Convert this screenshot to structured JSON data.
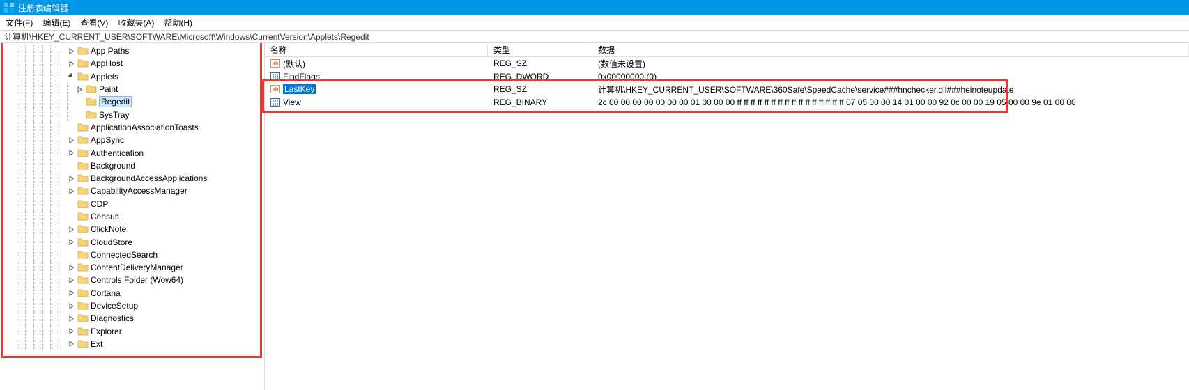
{
  "titlebar": {
    "title": "注册表编辑器"
  },
  "menubar": {
    "items": [
      "文件(F)",
      "编辑(E)",
      "查看(V)",
      "收藏夹(A)",
      "帮助(H)"
    ]
  },
  "addressbar": {
    "path": "计算机\\HKEY_CURRENT_USER\\SOFTWARE\\Microsoft\\Windows\\CurrentVersion\\Applets\\Regedit"
  },
  "tree": {
    "items": [
      {
        "label": "App Paths",
        "depth": 8,
        "exp": "closed"
      },
      {
        "label": "AppHost",
        "depth": 8,
        "exp": "closed"
      },
      {
        "label": "Applets",
        "depth": 8,
        "exp": "open"
      },
      {
        "label": "Paint",
        "depth": 9,
        "exp": "closed"
      },
      {
        "label": "Regedit",
        "depth": 9,
        "exp": "none",
        "selected": true
      },
      {
        "label": "SysTray",
        "depth": 9,
        "exp": "none"
      },
      {
        "label": "ApplicationAssociationToasts",
        "depth": 8,
        "exp": "none"
      },
      {
        "label": "AppSync",
        "depth": 8,
        "exp": "closed"
      },
      {
        "label": "Authentication",
        "depth": 8,
        "exp": "closed"
      },
      {
        "label": "Background",
        "depth": 8,
        "exp": "none"
      },
      {
        "label": "BackgroundAccessApplications",
        "depth": 8,
        "exp": "closed"
      },
      {
        "label": "CapabilityAccessManager",
        "depth": 8,
        "exp": "closed"
      },
      {
        "label": "CDP",
        "depth": 8,
        "exp": "none"
      },
      {
        "label": "Census",
        "depth": 8,
        "exp": "none"
      },
      {
        "label": "ClickNote",
        "depth": 8,
        "exp": "closed"
      },
      {
        "label": "CloudStore",
        "depth": 8,
        "exp": "closed"
      },
      {
        "label": "ConnectedSearch",
        "depth": 8,
        "exp": "none"
      },
      {
        "label": "ContentDeliveryManager",
        "depth": 8,
        "exp": "closed"
      },
      {
        "label": "Controls Folder (Wow64)",
        "depth": 8,
        "exp": "closed"
      },
      {
        "label": "Cortana",
        "depth": 8,
        "exp": "closed"
      },
      {
        "label": "DeviceSetup",
        "depth": 8,
        "exp": "closed"
      },
      {
        "label": "Diagnostics",
        "depth": 8,
        "exp": "closed"
      },
      {
        "label": "Explorer",
        "depth": 8,
        "exp": "closed"
      },
      {
        "label": "Ext",
        "depth": 8,
        "exp": "closed"
      }
    ]
  },
  "list": {
    "headers": {
      "name": "名称",
      "type": "类型",
      "data": "数据"
    },
    "rows": [
      {
        "name": "(默认)",
        "type": "REG_SZ",
        "data": "(数值未设置)",
        "icon": "ab",
        "selected": false
      },
      {
        "name": "FindFlags",
        "type": "REG_DWORD",
        "data": "0x00000000 (0)",
        "icon": "bin",
        "selected": false,
        "obscured": true
      },
      {
        "name": "LastKey",
        "type": "REG_SZ",
        "data": "计算机\\HKEY_CURRENT_USER\\SOFTWARE\\360Safe\\SpeedCache\\service###hnchecker.dll###heinoteupdate",
        "icon": "ab",
        "selected": true
      },
      {
        "name": "View",
        "type": "REG_BINARY",
        "data": "2c 00 00 00 00 00 00 00 01 00 00 00 ff ff ff ff ff ff ff ff ff ff ff ff ff ff ff ff 07 05 00 00 14 01 00 00 92 0c 00 00 19 05 00 00 9e 01 00 00",
        "icon": "bin",
        "selected": false
      }
    ]
  }
}
